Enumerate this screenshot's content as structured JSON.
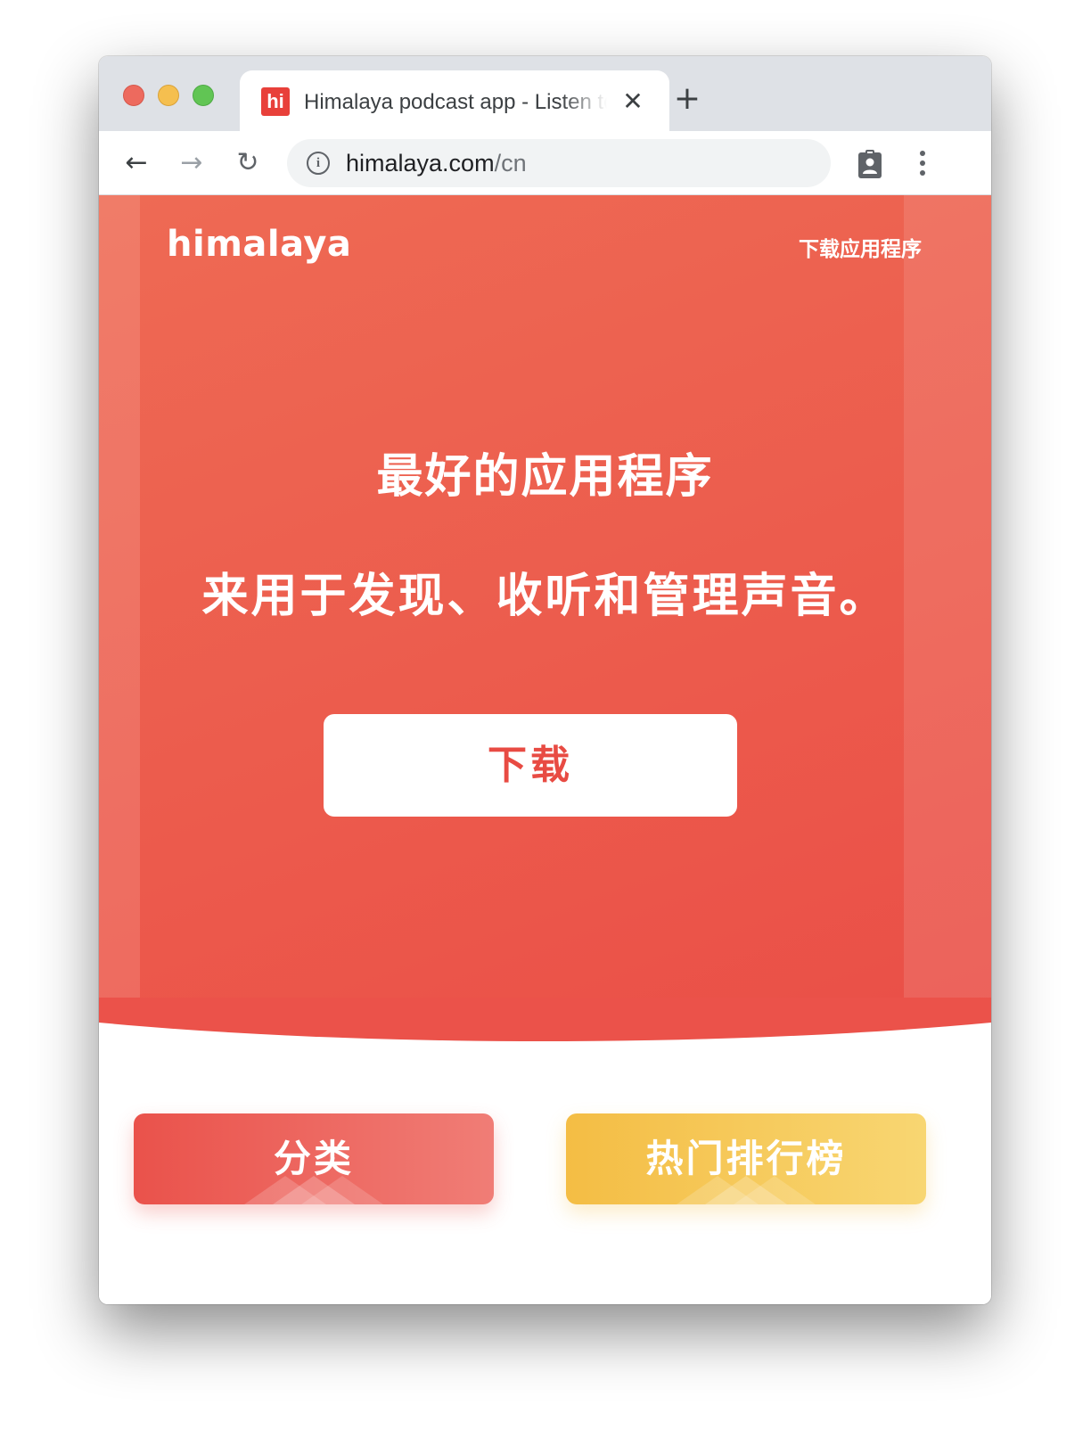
{
  "browser": {
    "tab": {
      "favicon_text": "hi",
      "title": "Himalaya podcast app - Listen to podcasts",
      "close_glyph": "✕"
    },
    "new_tab_glyph": "+",
    "toolbar": {
      "back_glyph": "←",
      "forward_glyph": "→",
      "reload_glyph": "↻",
      "info_glyph": "i",
      "url_host": "himalaya.com",
      "url_path": "/cn"
    },
    "icons": {
      "profile": "profile-icon",
      "menu": "kebab-menu-icon"
    }
  },
  "page": {
    "logo": "himalaya",
    "nav_download": "下载应用程序",
    "headline_line1": "最好的应用程序",
    "headline_line2": "来用于发现、收听和管理声音。",
    "download_button": "下载",
    "cards": {
      "categories": "分类",
      "ranking": "热门排行榜"
    },
    "colors": {
      "hero_red": "#EC5A4C",
      "download_text_red": "#E84B43",
      "categories_red": "#EA524B",
      "ranking_yellow": "#F4BD44"
    }
  }
}
